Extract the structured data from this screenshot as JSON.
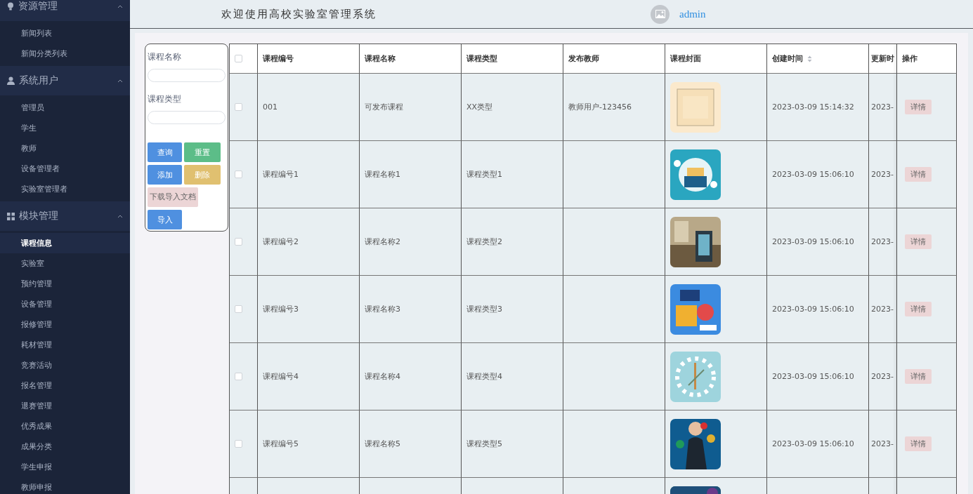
{
  "sidebar": {
    "groups": [
      {
        "label": "资源管理",
        "expanded": true,
        "items": [
          {
            "label": "新闻列表",
            "selected": false
          },
          {
            "label": "新闻分类列表",
            "selected": false
          }
        ]
      },
      {
        "label": "系统用户",
        "expanded": true,
        "items": [
          {
            "label": "管理员",
            "selected": false
          },
          {
            "label": "学生",
            "selected": false
          },
          {
            "label": "教师",
            "selected": false
          },
          {
            "label": "设备管理者",
            "selected": false
          },
          {
            "label": "实验室管理者",
            "selected": false
          }
        ]
      },
      {
        "label": "模块管理",
        "expanded": true,
        "items": [
          {
            "label": "课程信息",
            "selected": true
          },
          {
            "label": "实验室",
            "selected": false
          },
          {
            "label": "预约管理",
            "selected": false
          },
          {
            "label": "设备管理",
            "selected": false
          },
          {
            "label": "报修管理",
            "selected": false
          },
          {
            "label": "耗材管理",
            "selected": false
          },
          {
            "label": "竞赛活动",
            "selected": false
          },
          {
            "label": "报名管理",
            "selected": false
          },
          {
            "label": "退赛管理",
            "selected": false
          },
          {
            "label": "优秀成果",
            "selected": false
          },
          {
            "label": "成果分类",
            "selected": false
          },
          {
            "label": "学生申报",
            "selected": false
          },
          {
            "label": "教师申报",
            "selected": false
          }
        ]
      }
    ]
  },
  "header": {
    "title": "欢迎使用高校实验室管理系统",
    "user": "admin"
  },
  "filter": {
    "fields": [
      {
        "label": "课程名称"
      },
      {
        "label": "课程类型"
      }
    ],
    "buttons": [
      {
        "label": "查询",
        "kind": "primary"
      },
      {
        "label": "重置",
        "kind": "success"
      },
      {
        "label": "添加",
        "kind": "primary"
      },
      {
        "label": "删除",
        "kind": "warning"
      },
      {
        "label": "下载导入文档",
        "kind": "light"
      },
      {
        "label": "导入",
        "kind": "primary"
      }
    ]
  },
  "table": {
    "select_all": {
      "checked": false
    },
    "columns": [
      {
        "label": "课程编号",
        "sortable": false
      },
      {
        "label": "课程名称",
        "sortable": false
      },
      {
        "label": "课程类型",
        "sortable": false
      },
      {
        "label": "发布教师",
        "sortable": false
      },
      {
        "label": "课程封面",
        "sortable": false
      },
      {
        "label": "创建时间",
        "sortable": true
      },
      {
        "label": "更新时",
        "sortable": false
      },
      {
        "label": "操作",
        "sortable": false
      }
    ],
    "rows": [
      {
        "checked": false,
        "cells": [
          "001",
          "可发布课程",
          "XX类型",
          "教师用户-123456"
        ],
        "cover": {
          "kind": "picture"
        },
        "created": "2023-03-09 15:14:32",
        "updated": "2023-",
        "action": "详情"
      },
      {
        "checked": false,
        "cells": [
          "课程编号1",
          "课程名称1",
          "课程类型1"
        ],
        "cover": {
          "kind": "picture"
        },
        "created": "2023-03-09 15:06:10",
        "updated": "2023-",
        "action": "详情"
      },
      {
        "checked": false,
        "cells": [
          "课程编号2",
          "课程名称2",
          "课程类型2"
        ],
        "cover": {
          "kind": "picture"
        },
        "created": "2023-03-09 15:06:10",
        "updated": "2023-",
        "action": "详情"
      },
      {
        "checked": false,
        "cells": [
          "课程编号3",
          "课程名称3",
          "课程类型3"
        ],
        "cover": {
          "kind": "picture"
        },
        "created": "2023-03-09 15:06:10",
        "updated": "2023-",
        "action": "详情"
      },
      {
        "checked": false,
        "cells": [
          "课程编号4",
          "课程名称4",
          "课程类型4"
        ],
        "cover": {
          "kind": "picture"
        },
        "created": "2023-03-09 15:06:10",
        "updated": "2023-",
        "action": "详情"
      },
      {
        "checked": false,
        "cells": [
          "课程编号5",
          "课程名称5",
          "课程类型5"
        ],
        "cover": {
          "kind": "picture"
        },
        "created": "2023-03-09 15:06:10",
        "updated": "2023-",
        "action": "详情"
      },
      {
        "cover": {
          "kind": "picture"
        }
      }
    ]
  }
}
